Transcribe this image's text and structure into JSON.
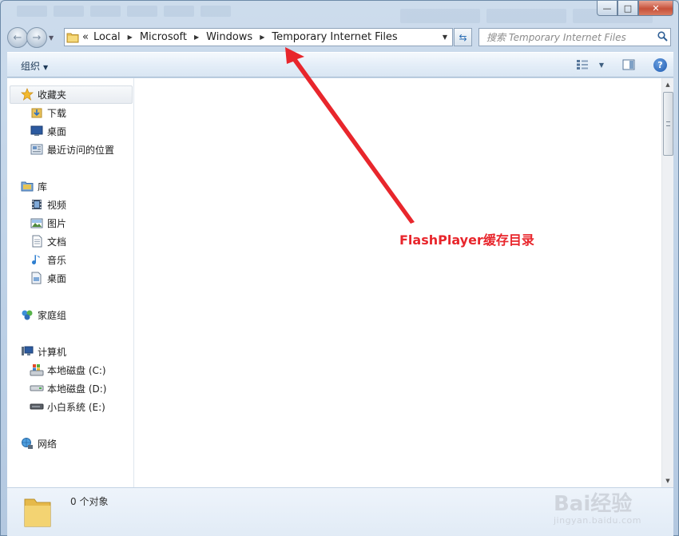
{
  "window": {
    "caption": {
      "minimize": "—",
      "maximize": "□",
      "close": "✕"
    }
  },
  "nav": {
    "back_icon": "back-arrow-icon",
    "forward_icon": "forward-arrow-icon"
  },
  "address": {
    "overflow": "«",
    "crumbs": [
      "Local",
      "Microsoft",
      "Windows",
      "Temporary Internet Files"
    ]
  },
  "search": {
    "placeholder": "搜索 Temporary Internet Files"
  },
  "toolbar": {
    "organize_label": "组织"
  },
  "sidebar": {
    "favorites": {
      "label": "收藏夹",
      "items": [
        {
          "label": "下载",
          "icon": "download-folder-icon"
        },
        {
          "label": "桌面",
          "icon": "desktop-icon"
        },
        {
          "label": "最近访问的位置",
          "icon": "recent-places-icon"
        }
      ]
    },
    "libraries": {
      "label": "库",
      "items": [
        {
          "label": "视频",
          "icon": "video-library-icon"
        },
        {
          "label": "图片",
          "icon": "pictures-library-icon"
        },
        {
          "label": "文档",
          "icon": "documents-library-icon"
        },
        {
          "label": "音乐",
          "icon": "music-library-icon"
        },
        {
          "label": "桌面",
          "icon": "desktop-library-icon"
        }
      ]
    },
    "homegroup": {
      "label": "家庭组"
    },
    "computer": {
      "label": "计算机",
      "items": [
        {
          "label": "本地磁盘 (C:)",
          "icon": "system-drive-icon"
        },
        {
          "label": "本地磁盘 (D:)",
          "icon": "hard-drive-icon"
        },
        {
          "label": "小白系统 (E:)",
          "icon": "removable-drive-icon"
        }
      ]
    },
    "network": {
      "label": "网络"
    }
  },
  "annotation": {
    "text": "FlashPlayer缓存目录"
  },
  "details": {
    "count_text": "0 个对象"
  },
  "watermark": {
    "brand": "Bai经验",
    "url": "jingyan.baidu.com"
  },
  "colors": {
    "annotation": "#e8262c",
    "accent": "#1d59b0"
  }
}
